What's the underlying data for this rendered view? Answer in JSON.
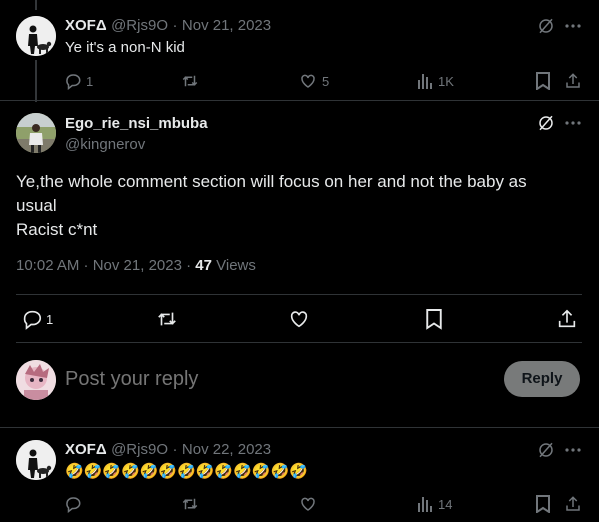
{
  "colors": {
    "background": "#000000",
    "text": "#e7e9ea",
    "muted": "#71767b",
    "divider": "#2f3336",
    "reply_button_bg": "#787a7a",
    "reply_button_text": "#0f1419"
  },
  "reply1": {
    "display_name": "XOFΔ",
    "handle": "@Rjs9O",
    "sep": "·",
    "date": "Nov 21, 2023",
    "text": "Ye it's a non-N kid",
    "replies": "1",
    "likes": "5",
    "views": "1K",
    "icons": [
      "grok-icon",
      "more-icon",
      "reply-icon",
      "retweet-icon",
      "like-icon",
      "views-icon",
      "bookmark-icon",
      "share-icon"
    ]
  },
  "main": {
    "display_name": "Ego_rie_nsi_mbuba",
    "handle": "@kingnerov",
    "text_line1": "Ye,the whole comment section will focus on her and not the baby as",
    "text_line2": "usual",
    "text_line3": "Racist c*nt",
    "time": "10:02 AM · Nov 21, 2023 ·",
    "views_count": "47",
    "views_label": "Views",
    "replies": "1"
  },
  "compose": {
    "placeholder": "Post your reply",
    "button": "Reply"
  },
  "reply2": {
    "display_name": "XOFΔ",
    "handle": "@Rjs9O",
    "sep": "·",
    "date": "Nov 22, 2023",
    "text": "🤣🤣🤣🤣🤣🤣🤣🤣🤣🤣🤣🤣🤣",
    "views": "14"
  }
}
